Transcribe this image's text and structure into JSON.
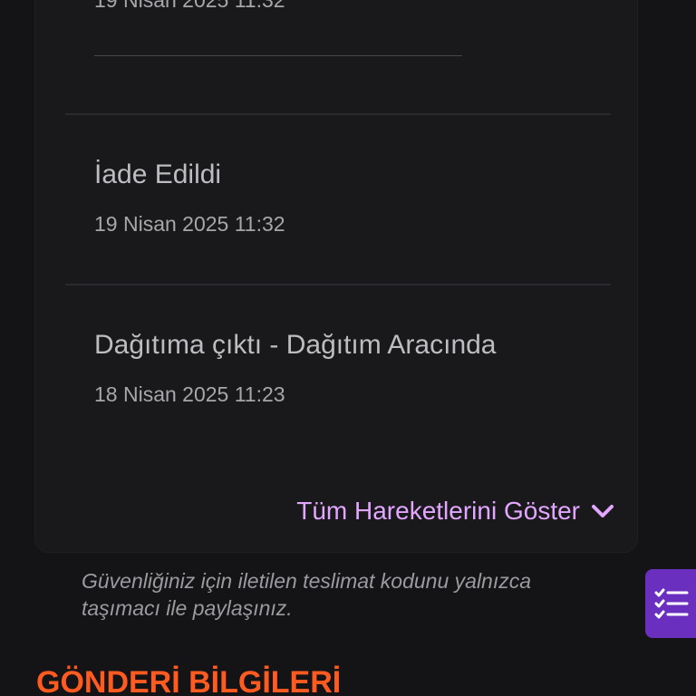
{
  "timeline": {
    "partial_date": "19 Nisan 2025 11:32",
    "events": [
      {
        "title": "İade Edildi",
        "date": "19 Nisan 2025 11:32"
      },
      {
        "title": "Dağıtıma çıktı - Dağıtım Aracında",
        "date": "18 Nisan 2025 11:23"
      }
    ],
    "show_all_label": "Tüm Hareketlerini Göster",
    "show_all_icon": "chevron-down-icon"
  },
  "security_note": "Güvenliğiniz için iletilen teslimat kodunu yalnızca taşımacı ile paylaşınız.",
  "section_title": "GÖNDERİ BİLGİLERİ",
  "side_button": {
    "icon": "checklist-icon"
  },
  "colors": {
    "background": "#141416",
    "card": "#19191b",
    "accent_link": "#e3a6ff",
    "section_title": "#ff5a1f",
    "side_button": "#6b2fbf"
  }
}
